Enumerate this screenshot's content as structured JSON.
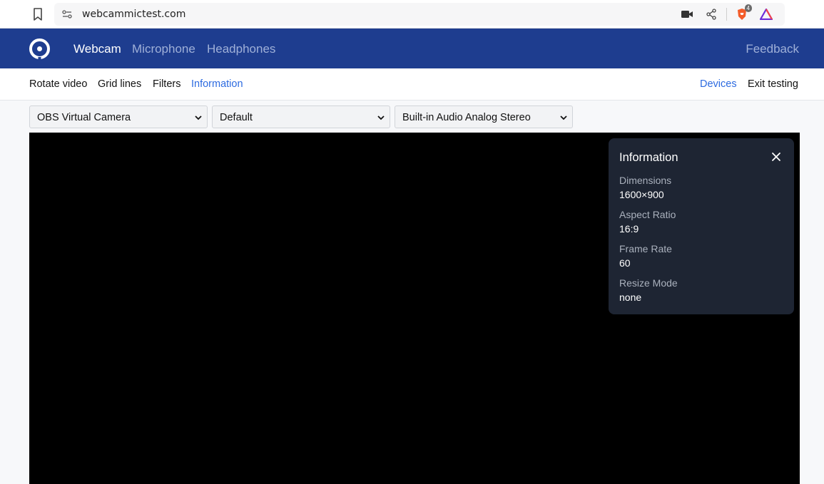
{
  "browser": {
    "url": "webcammictest.com",
    "extension_badge": "4"
  },
  "nav": {
    "tabs": [
      "Webcam",
      "Microphone",
      "Headphones"
    ],
    "feedback": "Feedback"
  },
  "toolbar": {
    "items": [
      "Rotate video",
      "Grid lines",
      "Filters",
      "Information"
    ],
    "devices": "Devices",
    "exit": "Exit testing"
  },
  "selects": {
    "camera": "OBS Virtual Camera",
    "resolution": "Default",
    "audio": "Built-in Audio Analog Stereo"
  },
  "info": {
    "title": "Information",
    "items": [
      {
        "label": "Dimensions",
        "value": "1600×900"
      },
      {
        "label": "Aspect Ratio",
        "value": "16:9"
      },
      {
        "label": "Frame Rate",
        "value": "60"
      },
      {
        "label": "Resize Mode",
        "value": "none"
      }
    ]
  },
  "colors": {
    "nav_bg": "#1e3d8f",
    "accent": "#2d6be0",
    "panel_bg": "#1e2533"
  }
}
